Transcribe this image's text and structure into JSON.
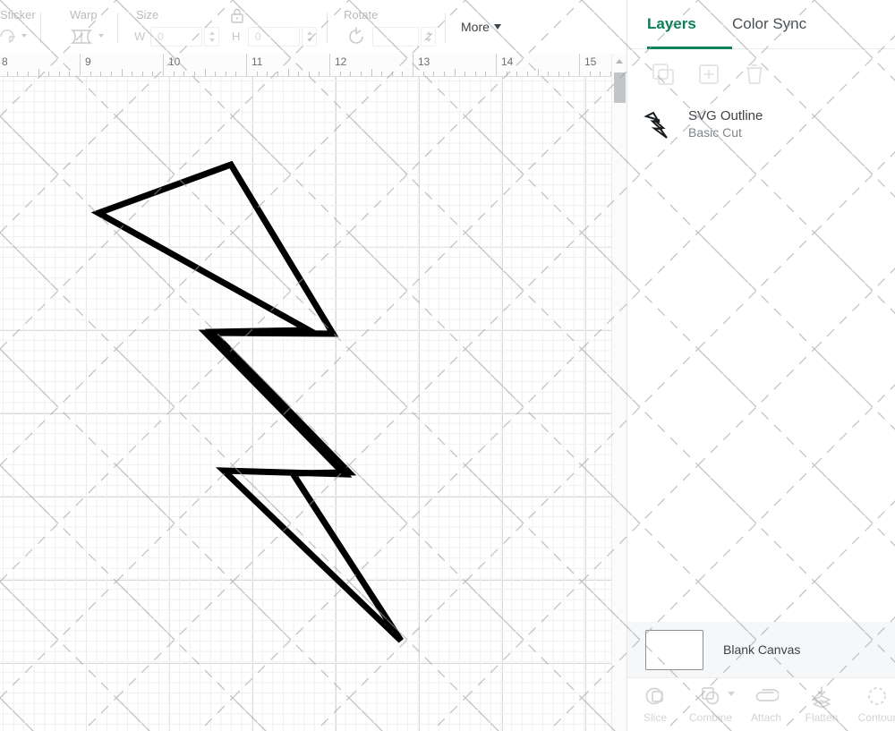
{
  "toolbar": {
    "groups": [
      {
        "label": "Sticker",
        "icon": "sticker-icon",
        "has_caret": true
      },
      {
        "label": "Warp",
        "icon": "warp-icon",
        "has_caret": true
      },
      {
        "label": "Size",
        "icon": "size-icon",
        "has_caret": false
      },
      {
        "label": "Rotate",
        "icon": "rotate-icon",
        "has_caret": false
      }
    ],
    "size": {
      "label": "Size",
      "width_letter": "W",
      "width_value": "0",
      "height_letter": "H",
      "height_value": "0",
      "lock_icon": "lock-icon"
    },
    "rotate": {
      "label": "Rotate",
      "value": "",
      "icon": "rotate-icon"
    },
    "more_label": "More"
  },
  "ruler": {
    "unit_labels": [
      "8",
      "9",
      "10",
      "11",
      "12",
      "13",
      "14",
      "15"
    ]
  },
  "canvas": {
    "artwork_name": "lightning-bolt-outline",
    "stroke_color": "#000000",
    "fill_color": "none"
  },
  "scrollbar": {
    "orientation": "vertical",
    "up_arrow": "scroll-up-arrow"
  },
  "right_panel": {
    "tabs": [
      {
        "label": "Layers",
        "active": true
      },
      {
        "label": "Color Sync",
        "active": false
      }
    ],
    "accent_color": "#0b8056",
    "layer_actions": [
      {
        "name": "group-icon",
        "enabled": false
      },
      {
        "name": "duplicate-icon",
        "enabled": false
      },
      {
        "name": "delete-icon",
        "enabled": false
      }
    ],
    "layers": [
      {
        "title": "SVG Outline",
        "subtitle": "Basic Cut",
        "thumbnail": "lightning-bolt-icon"
      }
    ],
    "blank_canvas": {
      "label": "Blank Canvas"
    },
    "bottom_tools": [
      {
        "label": "Slice",
        "icon": "slice-icon",
        "has_caret": false
      },
      {
        "label": "Combine",
        "icon": "combine-icon",
        "has_caret": true
      },
      {
        "label": "Attach",
        "icon": "attach-icon",
        "has_caret": false
      },
      {
        "label": "Flatten",
        "icon": "flatten-icon",
        "has_caret": false
      },
      {
        "label": "Contour",
        "icon": "contour-icon",
        "has_caret": false
      }
    ]
  }
}
